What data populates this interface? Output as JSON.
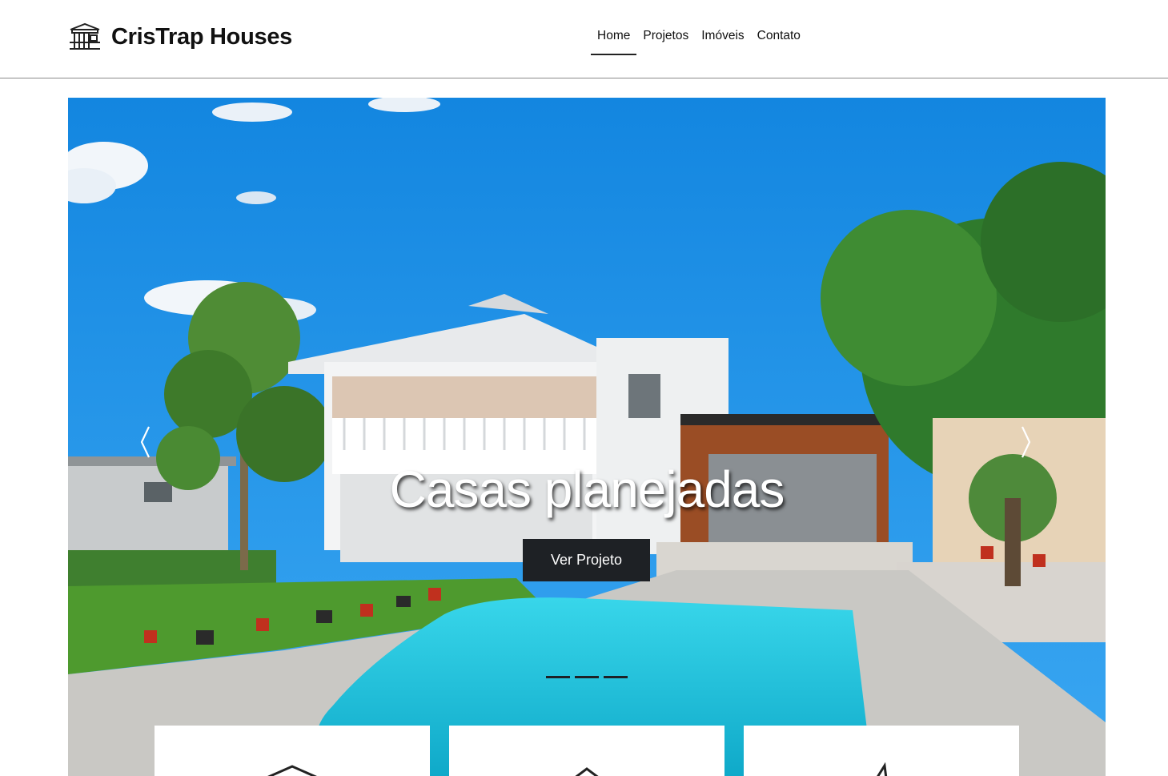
{
  "brand": {
    "name": "CrisTrap Houses",
    "logo_icon": "house-logo-icon"
  },
  "nav": {
    "items": [
      {
        "label": "Home",
        "active": true
      },
      {
        "label": "Projetos",
        "active": false
      },
      {
        "label": "Imóveis",
        "active": false
      },
      {
        "label": "Contato",
        "active": false
      }
    ]
  },
  "hero": {
    "title": "Casas planejadas",
    "button_label": "Ver Projeto",
    "prev_icon": "chevron-left-icon",
    "next_icon": "chevron-right-icon",
    "indicator_count": 3,
    "active_indicator": 0
  },
  "cards": [
    {
      "icon": "house-roof-icon"
    },
    {
      "icon": "house-roof-icon"
    },
    {
      "icon": "pen-icon"
    }
  ],
  "colors": {
    "header_border": "#8a8a8a",
    "button_bg": "#1e2125",
    "text": "#111111"
  }
}
